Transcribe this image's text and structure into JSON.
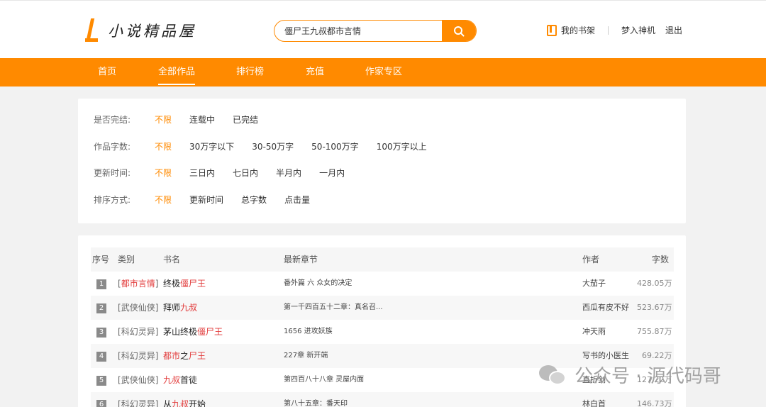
{
  "header": {
    "site_name": "小说精品屋",
    "search_value": "僵尸王九叔都市言情",
    "shelf_label": "我的书架",
    "username": "梦入神机",
    "logout_label": "退出",
    "accent_color": "#ff8a00"
  },
  "nav": {
    "items": [
      {
        "label": "首页"
      },
      {
        "label": "全部作品"
      },
      {
        "label": "排行榜"
      },
      {
        "label": "充值"
      },
      {
        "label": "作家专区"
      }
    ],
    "active": "全部作品"
  },
  "filters": {
    "status": {
      "label": "是否完结:",
      "options": [
        "不限",
        "连载中",
        "已完结"
      ],
      "selected": "不限"
    },
    "wordcount": {
      "label": "作品字数:",
      "options": [
        "不限",
        "30万字以下",
        "30-50万字",
        "50-100万字",
        "100万字以上"
      ],
      "selected": "不限"
    },
    "updated": {
      "label": "更新时间:",
      "options": [
        "不限",
        "三日内",
        "七日内",
        "半月内",
        "一月内"
      ],
      "selected": "不限"
    },
    "sort": {
      "label": "排序方式:",
      "options": [
        "不限",
        "更新时间",
        "总字数",
        "点击量"
      ],
      "selected": "不限"
    }
  },
  "table": {
    "headers": {
      "num": "序号",
      "cat": "类别",
      "name": "书名",
      "chapter": "最新章节",
      "author": "作者",
      "words": "字数"
    },
    "rows": [
      {
        "num": "1",
        "cat_open": "[",
        "cat": "都市言情",
        "cat_close": "]",
        "cat_hl": true,
        "name_a": "终极",
        "name_b": "僵尸王",
        "name_c": "",
        "chapter": "番外篇 六 众女的决定",
        "author": "大茄子",
        "words": "428.05万"
      },
      {
        "num": "2",
        "cat_open": "[",
        "cat": "武侠仙侠",
        "cat_close": "]",
        "cat_hl": false,
        "name_a": "拜师",
        "name_b": "九叔",
        "name_c": "",
        "chapter": "第一千四百五十二章：真名召...",
        "author": "西瓜有皮不好",
        "words": "523.67万"
      },
      {
        "num": "3",
        "cat_open": "[",
        "cat": "科幻灵异",
        "cat_close": "]",
        "cat_hl": false,
        "name_a": "茅山终极",
        "name_b": "僵尸王",
        "name_c": "",
        "chapter": "1656 进攻妖族",
        "author": "冲天雨",
        "words": "755.87万"
      },
      {
        "num": "4",
        "cat_open": "[",
        "cat": "科幻灵异",
        "cat_close": "]",
        "cat_hl": false,
        "name_a": "",
        "name_b": "都市",
        "name_c": "之",
        "name_d": "尸王",
        "chapter": "227章 新开端",
        "author": "写书的小医生",
        "words": "69.22万"
      },
      {
        "num": "5",
        "cat_open": "[",
        "cat": "武侠仙侠",
        "cat_close": "]",
        "cat_hl": false,
        "name_a": "",
        "name_b": "九叔",
        "name_c": "首徒",
        "chapter": "第四百八十八章 灵屋内面",
        "author": "直折剑",
        "words": "127.22万"
      },
      {
        "num": "6",
        "cat_open": "[",
        "cat": "科幻灵异",
        "cat_close": "]",
        "cat_hl": false,
        "name_a": "从",
        "name_b": "九叔",
        "name_c": "开始",
        "chapter": "第八十五章：番天印",
        "author": "林白首",
        "words": "146.73万"
      }
    ]
  },
  "watermark": {
    "text": "公众号 · 源代码哥"
  }
}
